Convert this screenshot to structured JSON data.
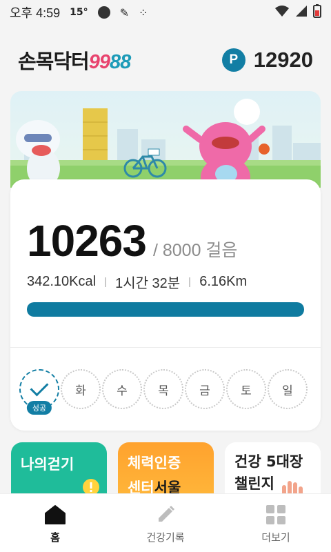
{
  "status_bar": {
    "time": "오후 4:59",
    "temperature": "15°",
    "icons": [
      "circle-icon",
      "glide-icon",
      "grid-dots-icon",
      "wifi-icon",
      "signal-icon",
      "battery-icon"
    ]
  },
  "header": {
    "logo_korean": "손목닥터",
    "logo_num1": "99",
    "logo_num2": "88",
    "points_icon_label": "P",
    "points_value": "12920"
  },
  "steps_card": {
    "steps": "10263",
    "goal": "/ 8000 걸음",
    "goal_progress": 1.0,
    "calories": "342.10Kcal",
    "duration": "1시간 32분",
    "distance": "6.16Km"
  },
  "week": {
    "done_badge": "성공",
    "days": [
      "화",
      "수",
      "목",
      "금",
      "토",
      "일"
    ]
  },
  "tiles": {
    "my_walk": "나의걷기",
    "fitness_line1": "체력인증",
    "fitness_line2a": "센터",
    "fitness_line2b": "서울",
    "challenge_line1": "건강 5대장",
    "challenge_line2": "챌린지"
  },
  "bottom_nav": [
    {
      "label": "홈",
      "icon": "home-icon"
    },
    {
      "label": "건강기록",
      "icon": "pencil-icon"
    },
    {
      "label": "더보기",
      "icon": "grid-icon"
    }
  ],
  "colors": {
    "accent": "#127ea4",
    "progress": "#0f7ba0",
    "tile_green": "#1fbc9a",
    "tile_orange": "#ffa22e",
    "logo_pink": "#e8436e",
    "logo_teal": "#1d9bb8"
  }
}
